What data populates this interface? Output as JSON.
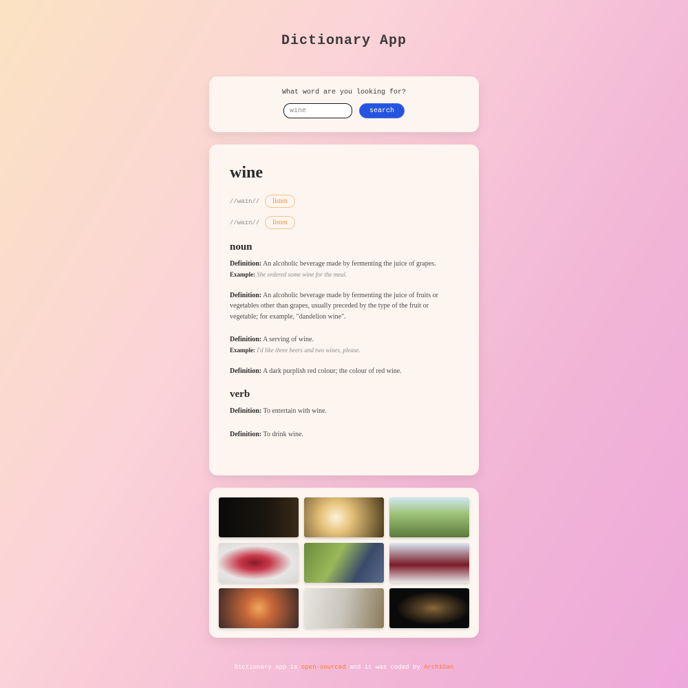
{
  "header": {
    "title": "Dictionary App"
  },
  "search": {
    "prompt": "What word are you looking for?",
    "value": "wine",
    "button": "search"
  },
  "result": {
    "word": "wine",
    "phonetics": [
      {
        "text": "//waɪn//",
        "listen": "listen"
      },
      {
        "text": "//waɪn//",
        "listen": "listen"
      }
    ],
    "meanings": [
      {
        "pos": "noun",
        "defs": [
          {
            "label": "Definition:",
            "text": "An alcoholic beverage made by fermenting the juice of grapes.",
            "exLabel": "Example:",
            "example": "She ordered some wine for the meal."
          },
          {
            "label": "Definition:",
            "text": "An alcoholic beverage made by fermenting the juice of fruits or vegetables other than grapes, usually preceded by the type of the fruit or vegetable; for example, \"dandelion wine\"."
          },
          {
            "label": "Definition:",
            "text": "A serving of wine.",
            "exLabel": "Example:",
            "example": "I'd like three beers and two wines, please."
          },
          {
            "label": "Definition:",
            "text": "A dark purplish red colour; the colour of red wine."
          }
        ]
      },
      {
        "pos": "verb",
        "defs": [
          {
            "label": "Definition:",
            "text": "To entertain with wine."
          },
          {
            "label": "Definition:",
            "text": "To drink wine."
          }
        ]
      }
    ]
  },
  "footer": {
    "pre": "Dictionary app is ",
    "link1": "open-sourced",
    "mid": " and it was coded by ",
    "link2": "ArchiGan"
  }
}
